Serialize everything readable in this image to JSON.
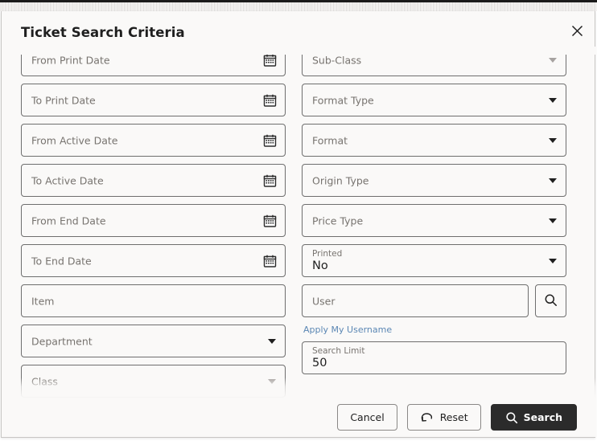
{
  "dialog": {
    "title": "Ticket Search Criteria",
    "close_icon": "close-icon"
  },
  "colors": {
    "dialog_background": "#faf9f8",
    "field_border": "#6e6e6e",
    "placeholder_text": "#77736f",
    "value_text": "#1f1f1f",
    "link_blue": "#5b87b4",
    "primary_button_background": "#2b2b2b",
    "primary_button_text": "#ffffff"
  },
  "form": {
    "left_column": [
      {
        "name": "from-print-date",
        "placeholder": "From Print Date",
        "type": "date",
        "value": "",
        "icon": "calendar-icon",
        "clipped_top": true
      },
      {
        "name": "to-print-date",
        "placeholder": "To Print Date",
        "type": "date",
        "value": "",
        "icon": "calendar-icon"
      },
      {
        "name": "from-active-date",
        "placeholder": "From Active Date",
        "type": "date",
        "value": "",
        "icon": "calendar-icon"
      },
      {
        "name": "to-active-date",
        "placeholder": "To Active Date",
        "type": "date",
        "value": "",
        "icon": "calendar-icon"
      },
      {
        "name": "from-end-date",
        "placeholder": "From End Date",
        "type": "date",
        "value": "",
        "icon": "calendar-icon"
      },
      {
        "name": "to-end-date",
        "placeholder": "To End Date",
        "type": "date",
        "value": "",
        "icon": "calendar-icon"
      },
      {
        "name": "item",
        "placeholder": "Item",
        "type": "text",
        "value": ""
      },
      {
        "name": "department",
        "placeholder": "Department",
        "type": "select",
        "value": "",
        "icon": "chevron-down-icon"
      },
      {
        "name": "class",
        "placeholder": "Class",
        "type": "select",
        "value": "",
        "icon": "chevron-down-icon",
        "clipped_bottom": true
      }
    ],
    "right_column": [
      {
        "name": "sub-class",
        "placeholder": "Sub-Class",
        "type": "select",
        "value": "",
        "icon": "chevron-down-icon",
        "clipped_top": true
      },
      {
        "name": "format-type",
        "placeholder": "Format Type",
        "type": "select",
        "value": "",
        "icon": "chevron-down-icon"
      },
      {
        "name": "format",
        "placeholder": "Format",
        "type": "select",
        "value": "",
        "icon": "chevron-down-icon"
      },
      {
        "name": "origin-type",
        "placeholder": "Origin Type",
        "type": "select",
        "value": "",
        "icon": "chevron-down-icon"
      },
      {
        "name": "price-type",
        "placeholder": "Price Type",
        "type": "select",
        "value": "",
        "icon": "chevron-down-icon"
      }
    ],
    "printed": {
      "label": "Printed",
      "value": "No",
      "icon": "chevron-down-icon"
    },
    "user": {
      "placeholder": "User",
      "value": "",
      "search_icon": "search-icon",
      "apply_link": "Apply My Username"
    },
    "search_limit": {
      "label": "Search Limit",
      "value": "50"
    }
  },
  "footer": {
    "cancel_label": "Cancel",
    "reset_label": "Reset",
    "reset_icon": "undo-arrow-icon",
    "search_label": "Search",
    "search_icon": "search-icon"
  }
}
